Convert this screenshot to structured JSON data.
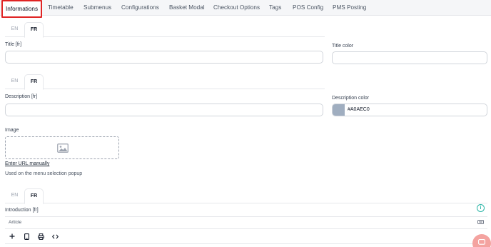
{
  "tabs": [
    {
      "label": "Informations"
    },
    {
      "label": "Timetable"
    },
    {
      "label": "Submenus"
    },
    {
      "label": "Configurations"
    },
    {
      "label": "Basket Modal"
    },
    {
      "label": "Checkout Options"
    },
    {
      "label": "Tags"
    },
    {
      "label": "POS Config"
    },
    {
      "label": "PMS Posting"
    }
  ],
  "active_tab": "Informations",
  "lang": {
    "en": "EN",
    "fr": "FR",
    "active": "FR"
  },
  "title_field": {
    "label": "Title [fr]",
    "value": ""
  },
  "title_color": {
    "label": "Title color",
    "value": ""
  },
  "description_field": {
    "label": "Description [fr]",
    "value": ""
  },
  "description_color": {
    "label": "Description color",
    "value": "#A0AEC0",
    "swatch": "#a0aec0"
  },
  "image": {
    "label": "Image",
    "icon": "image-placeholder-icon"
  },
  "enter_url_link": "Enter URL manually",
  "image_help": "Used on the menu selection popup",
  "introduction": {
    "label": "Introduction [fr]",
    "editor_type": "Article"
  },
  "toolbar_icons": [
    "plus-icon",
    "tablet-icon",
    "printer-icon",
    "code-icon"
  ],
  "colors": {
    "highlight": "#e02424",
    "accent": "#2bb5a6",
    "chat": "#f4a3a0"
  }
}
